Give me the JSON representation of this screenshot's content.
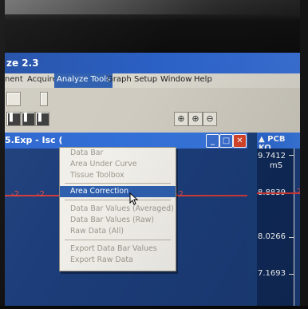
{
  "app": {
    "title": "ze 2.3"
  },
  "menubar": {
    "items": [
      {
        "label": "nent"
      },
      {
        "label": "Acquire"
      },
      {
        "label": "Analyze Tools"
      },
      {
        "label": "Graph"
      },
      {
        "label": "Setup"
      },
      {
        "label": "Window"
      },
      {
        "label": "Help"
      }
    ],
    "active_index": 2
  },
  "dropdown": {
    "items": [
      {
        "label": "Data Bar",
        "enabled": false
      },
      {
        "label": "Area Under Curve",
        "enabled": false
      },
      {
        "label": "Tissue Toolbox",
        "enabled": false
      },
      {
        "label": "Area Correction",
        "enabled": true,
        "highlighted": true
      },
      {
        "label": "Data Bar Values (Averaged)",
        "enabled": false
      },
      {
        "label": "Data Bar Values (Raw)",
        "enabled": false
      },
      {
        "label": "Raw Data (All)",
        "enabled": false
      },
      {
        "label": "Export Data Bar Values",
        "enabled": false
      },
      {
        "label": "Export Raw Data",
        "enabled": false
      }
    ]
  },
  "document": {
    "title": "5.Exp - Isc ("
  },
  "plot": {
    "trace_labels": [
      "-2",
      "-2",
      "-2"
    ]
  },
  "right_panel": {
    "title": "PCB KO",
    "axis_values": [
      "9.7412",
      "8.8839",
      "8.0266",
      "7.1693"
    ],
    "unit": "mS",
    "right_trace_label": "-2"
  },
  "colors": {
    "titlebar": "#2d63c9",
    "highlight": "#2e5fae",
    "trace": "#d23b37",
    "menu_bg": "#f1efe9"
  }
}
